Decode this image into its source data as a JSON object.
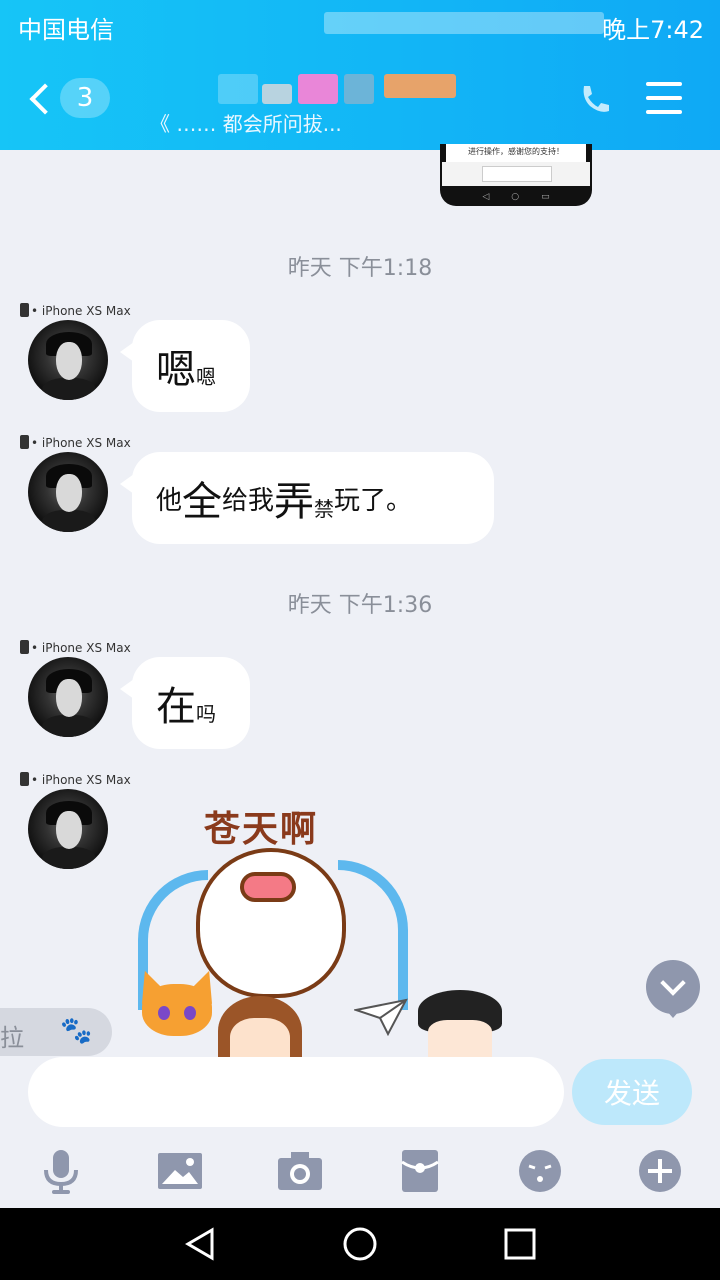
{
  "status": {
    "carrier": "中国电信",
    "time": "晚上7:42"
  },
  "header": {
    "unread_count": "3",
    "subtitle": "《 …… 都会所问拔..."
  },
  "screenshot_thumb": {
    "note": "进行操作，感谢您的支持！"
  },
  "messages": [
    {
      "timestamp": "昨天 下午1:18",
      "device": "iPhone XS Max",
      "parts": [
        "嗯",
        "嗯"
      ]
    },
    {
      "device": "iPhone XS Max",
      "parts": [
        "他",
        "全",
        "给我",
        "弄",
        "禁",
        "玩了。"
      ]
    },
    {
      "timestamp": "昨天 下午1:36",
      "device": "iPhone XS Max",
      "parts": [
        "在",
        "吗"
      ]
    },
    {
      "device": "iPhone XS Max",
      "sticker_caption": "苍天啊"
    }
  ],
  "pull_tab": {
    "label": "拉"
  },
  "input": {
    "placeholder": "",
    "send_label": "发送"
  },
  "toolbar_icons": [
    "microphone-icon",
    "image-icon",
    "camera-icon",
    "red-packet-icon",
    "emoji-icon",
    "plus-icon"
  ],
  "colors": {
    "header": "#16c5f7",
    "send_disabled": "#bde8fb",
    "icon": "#8f97ad"
  }
}
